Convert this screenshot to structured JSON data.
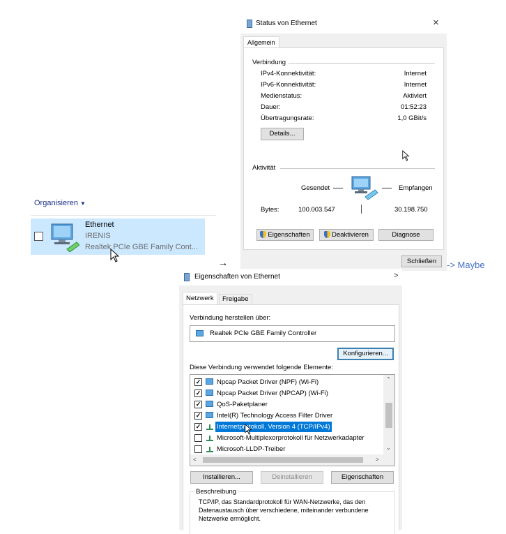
{
  "explorer": {
    "organize_label": "Organisieren",
    "item": {
      "name": "Ethernet",
      "network": "IRENIS",
      "adapter": "Realtek PCIe GBE Family Cont..."
    }
  },
  "arrow_right": "→",
  "maybe_note": "-> Maybe",
  "status_dialog": {
    "title": "Status von Ethernet",
    "close": "×",
    "tab": "Allgemein",
    "verbindung_label": "Verbindung",
    "rows": [
      {
        "label": "IPv4-Konnektivität:",
        "value": "Internet"
      },
      {
        "label": "IPv6-Konnektivität:",
        "value": "Internet"
      },
      {
        "label": "Medienstatus:",
        "value": "Aktiviert"
      },
      {
        "label": "Dauer:",
        "value": "01:52:23"
      },
      {
        "label": "Übertragungsrate:",
        "value": "1,0 GBit/s"
      }
    ],
    "details_button": "Details...",
    "aktivitaet_label": "Aktivität",
    "gesendet": "Gesendet",
    "empfangen": "Empfangen",
    "bytes_label": "Bytes:",
    "bytes_sent": "100.003.547",
    "bytes_received": "30.198.750",
    "eigenschaften_button": "Eigenschaften",
    "deaktivieren_button": "Deaktivieren",
    "diagnose_button": "Diagnose",
    "schliessen_button": "Schließen"
  },
  "props_dialog": {
    "title": "Eigenschaften von Ethernet",
    "tabs": [
      "Netzwerk",
      "Freigabe"
    ],
    "connect_via_label": "Verbindung herstellen über:",
    "adapter": "Realtek PCIe GBE Family Controller",
    "configure_button": "Konfigurieren...",
    "elements_label": "Diese Verbindung verwendet folgende Elemente:",
    "items": [
      {
        "label": "Npcap Packet Driver (NPF) (Wi-Fi)",
        "checked": true
      },
      {
        "label": "Npcap Packet Driver (NPCAP) (Wi-Fi)",
        "checked": true
      },
      {
        "label": "QoS-Paketplaner",
        "checked": true
      },
      {
        "label": "Intel(R) Technology Access Filter Driver",
        "checked": true
      },
      {
        "label": "Internetprotokoll, Version 4 (TCP/IPv4)",
        "checked": true,
        "selected": true
      },
      {
        "label": "Microsoft-Multiplexorprotokoll für Netzwerkadapter",
        "checked": false
      },
      {
        "label": "Microsoft-LLDP-Treiber",
        "checked": false
      }
    ],
    "install_button": "Installieren...",
    "uninstall_button": "Deinstallieren",
    "properties_button": "Eigenschaften",
    "description_label": "Beschreibung",
    "description_text": [
      "TCP/IP, das Standardprotokoll für WAN-Netzwerke, das den",
      "Datenaustausch über verschiedene, miteinander verbundene",
      "Netzwerke ermöglicht."
    ]
  }
}
